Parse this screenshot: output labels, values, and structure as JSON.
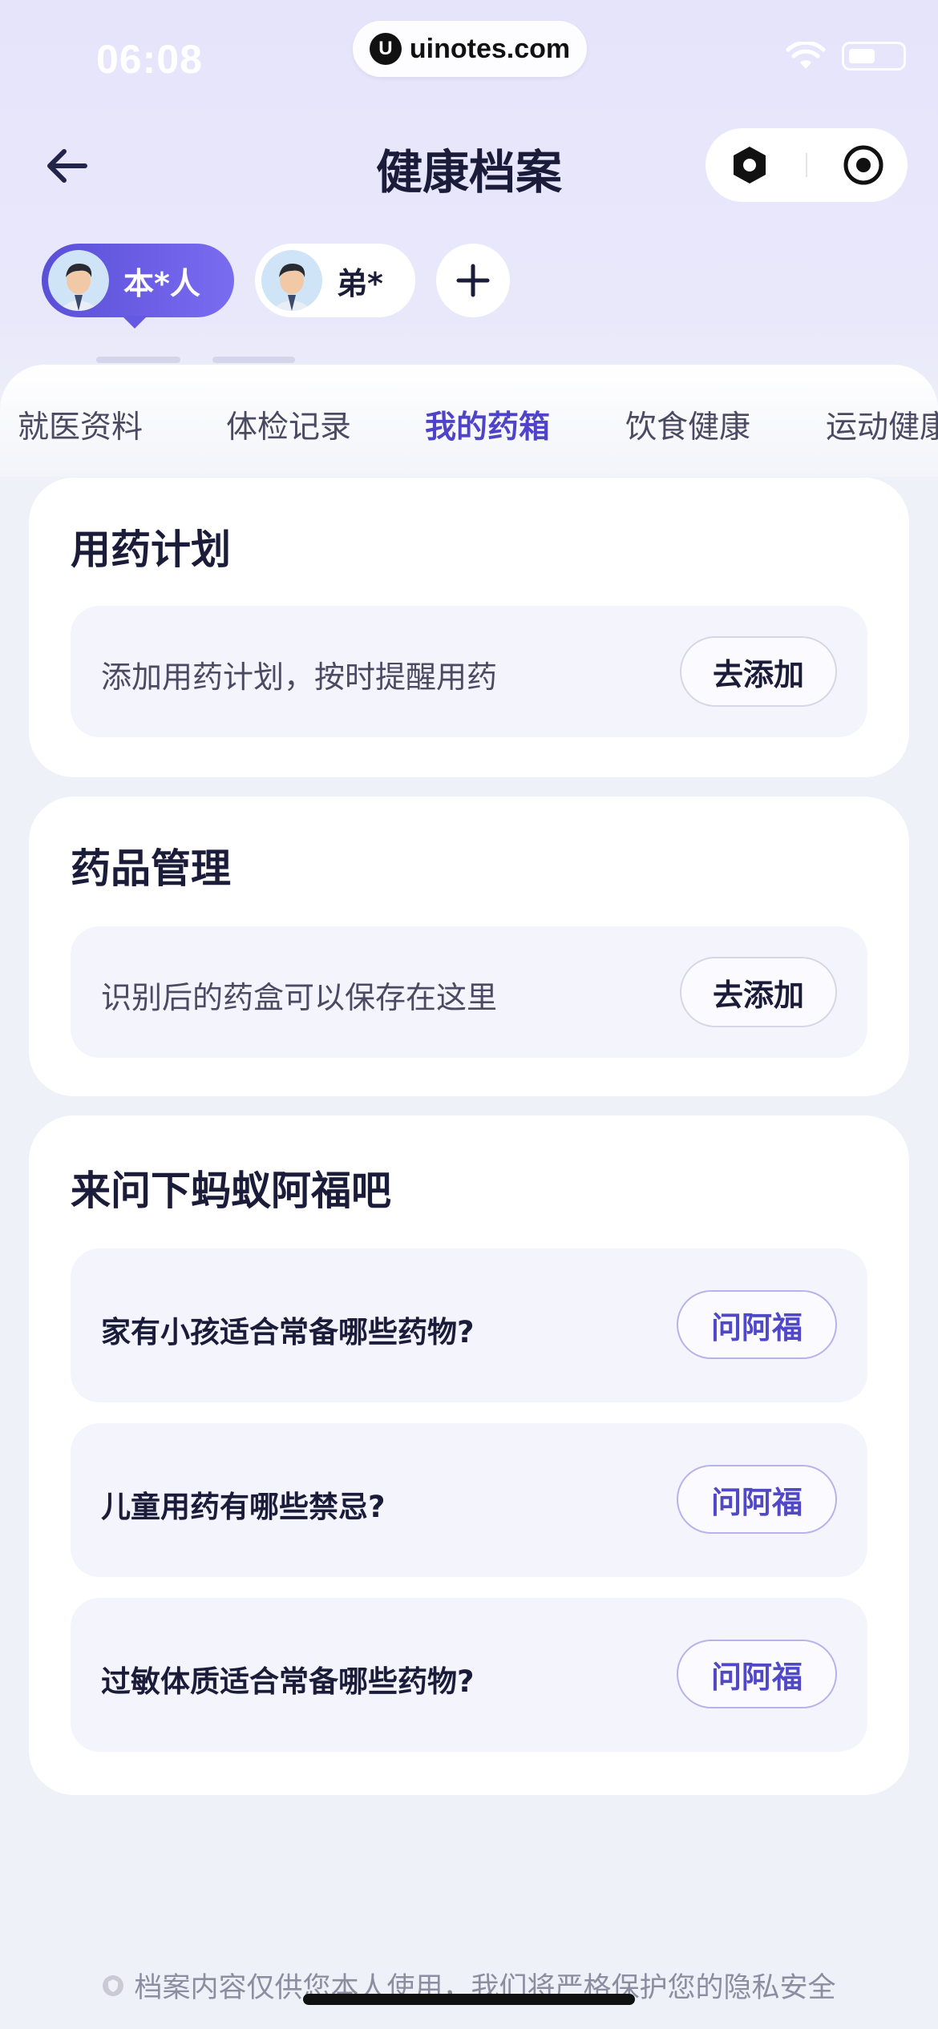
{
  "status_bar": {
    "time": "06:08",
    "watermark": "uinotes.com"
  },
  "header": {
    "title": "健康档案"
  },
  "members": [
    {
      "label": "本*人",
      "active": true
    },
    {
      "label": "弟*",
      "active": false
    }
  ],
  "add_member_label": "+",
  "tabs": [
    "就医资料",
    "体检记录",
    "我的药箱",
    "饮食健康",
    "运动健康"
  ],
  "active_tab": "我的药箱",
  "plan_card": {
    "title": "用药计划",
    "hint": "添加用药计划，按时提醒用药",
    "button": "去添加"
  },
  "drug_card": {
    "title": "药品管理",
    "hint": "识别后的药盒可以保存在这里",
    "button": "去添加"
  },
  "ask_card": {
    "title": "来问下蚂蚁阿福吧",
    "questions": [
      {
        "text": "家有小孩适合常备哪些药物?",
        "button": "问阿福"
      },
      {
        "text": "儿童用药有哪些禁忌?",
        "button": "问阿福"
      },
      {
        "text": "过敏体质适合常备哪些药物?",
        "button": "问阿福"
      }
    ]
  },
  "footer": {
    "note": "档案内容仅供您本人使用，我们将严格保护您的隐私安全"
  },
  "colors": {
    "accent": "#4f44c8",
    "page_bg": "#eef1f7",
    "header_bg": "#e6e4fb"
  },
  "icons": [
    "back-arrow-icon",
    "record-icon",
    "eye-icon",
    "plus-icon",
    "shield-icon"
  ]
}
